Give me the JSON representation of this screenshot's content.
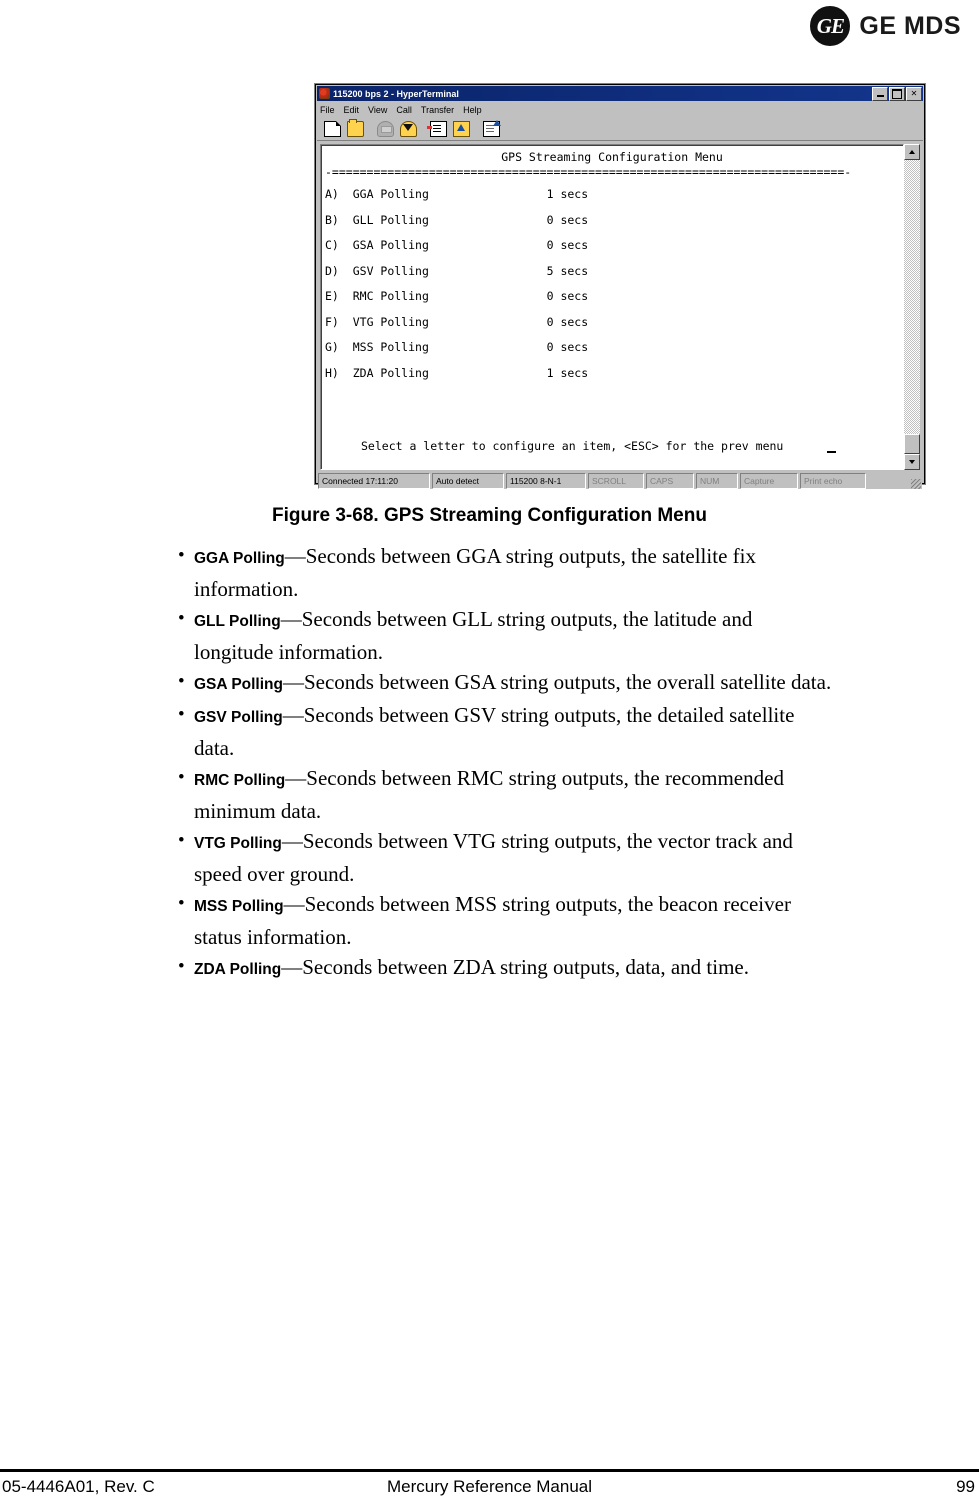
{
  "brand": {
    "monogram": "GE",
    "name": "GE MDS"
  },
  "terminal_window": {
    "title": "115200 bps 2 - HyperTerminal",
    "title_icon": "hyperterminal-icon",
    "window_buttons": [
      {
        "name": "minimize",
        "glyph": "_"
      },
      {
        "name": "maximize",
        "glyph": "□"
      },
      {
        "name": "close",
        "glyph": "✕"
      }
    ],
    "menus": [
      "File",
      "Edit",
      "View",
      "Call",
      "Transfer",
      "Help"
    ],
    "toolbar": [
      {
        "name": "new-connection-icon",
        "label": "New"
      },
      {
        "name": "open-connection-icon",
        "label": "Open"
      },
      {
        "name": "dial-icon",
        "label": "Call",
        "disabled": true
      },
      {
        "name": "hangup-icon",
        "label": "Disconnect"
      },
      {
        "name": "send-file-icon",
        "label": "Send"
      },
      {
        "name": "receive-file-icon",
        "label": "Receive"
      },
      {
        "name": "properties-icon",
        "label": "Properties"
      }
    ],
    "screen": {
      "heading": "GPS Streaming Configuration Menu",
      "rule": "-==========================================================================-",
      "menu_items": [
        {
          "key": "A)",
          "label": "GGA Polling",
          "value": "1 secs"
        },
        {
          "key": "B)",
          "label": "GLL Polling",
          "value": "0 secs"
        },
        {
          "key": "C)",
          "label": "GSA Polling",
          "value": "0 secs"
        },
        {
          "key": "D)",
          "label": "GSV Polling",
          "value": "5 secs"
        },
        {
          "key": "E)",
          "label": "RMC Polling",
          "value": "0 secs"
        },
        {
          "key": "F)",
          "label": "VTG Polling",
          "value": "0 secs"
        },
        {
          "key": "G)",
          "label": "MSS Polling",
          "value": "0 secs"
        },
        {
          "key": "H)",
          "label": "ZDA Polling",
          "value": "1 secs"
        }
      ],
      "prompt": "Select a letter to configure an item, <ESC> for the prev menu"
    },
    "status_bar": {
      "connected": "Connected 17:11:20",
      "detect": "Auto detect",
      "line_settings": "115200 8-N-1",
      "scroll": "SCROLL",
      "caps": "CAPS",
      "num": "NUM",
      "capture": "Capture",
      "print_echo": "Print echo"
    }
  },
  "figure": {
    "caption": "Figure 3-68. GPS Streaming Configuration Menu"
  },
  "bullets": [
    {
      "term": "GGA Polling",
      "text": "—Seconds between GGA string outputs, the satellite fix information."
    },
    {
      "term": "GLL Polling",
      "text": "—Seconds between GLL string outputs, the latitude and longitude information."
    },
    {
      "term": "GSA Polling",
      "text": "—Seconds between GSA string outputs, the overall satellite data."
    },
    {
      "term": "GSV Polling",
      "text": "—Seconds between GSV string outputs, the detailed satellite data."
    },
    {
      "term": "RMC Polling",
      "text": "—Seconds between RMC string outputs, the recommended minimum data."
    },
    {
      "term": "VTG Polling",
      "text": "—Seconds between VTG string outputs, the vector track and speed over ground."
    },
    {
      "term": "MSS Polling",
      "text": "—Seconds between MSS string outputs, the beacon receiver status information."
    },
    {
      "term": "ZDA Polling",
      "text": "—Seconds between ZDA string outputs, data, and time."
    }
  ],
  "footer": {
    "doc_number": "05-4446A01, Rev. C",
    "manual_title": "Mercury Reference Manual",
    "page_number": "99"
  }
}
